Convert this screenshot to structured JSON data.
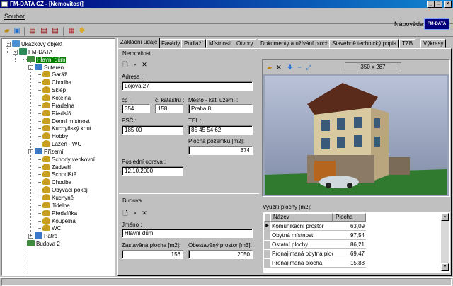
{
  "window": {
    "title": "FM-DATA CZ - [Nemovitost]"
  },
  "menu": {
    "soubor": "Soubor",
    "help": "Nápověda",
    "logo": "FM-DATA"
  },
  "tree": {
    "nodes": [
      {
        "label": "Ukázkový objekt",
        "level": 0
      },
      {
        "label": "FM-DATA",
        "level": 1
      },
      {
        "label": "Hlavní dům",
        "level": 2,
        "selected": true
      },
      {
        "label": "Suterén",
        "level": 3
      },
      {
        "label": "Garáž",
        "level": 4
      },
      {
        "label": "Chodba",
        "level": 4
      },
      {
        "label": "Sklep",
        "level": 4
      },
      {
        "label": "Kotelna",
        "level": 4
      },
      {
        "label": "Prádelna",
        "level": 4
      },
      {
        "label": "Předsíň",
        "level": 4
      },
      {
        "label": "Denní místnost",
        "level": 4
      },
      {
        "label": "Kuchyňský kout",
        "level": 4
      },
      {
        "label": "Hobby",
        "level": 4
      },
      {
        "label": "Lázeň - WC",
        "level": 4
      },
      {
        "label": "Přízemí",
        "level": 3
      },
      {
        "label": "Schody venkovní",
        "level": 4
      },
      {
        "label": "Zádveří",
        "level": 4
      },
      {
        "label": "Schodiště",
        "level": 4
      },
      {
        "label": "Chodba",
        "level": 4
      },
      {
        "label": "Obývací pokoj",
        "level": 4
      },
      {
        "label": "Kuchyně",
        "level": 4
      },
      {
        "label": "Jídelna",
        "level": 4
      },
      {
        "label": "Předsíňka",
        "level": 4
      },
      {
        "label": "Koupelna",
        "level": 4
      },
      {
        "label": "WC",
        "level": 4
      },
      {
        "label": "Patro",
        "level": 3
      },
      {
        "label": "Budova 2",
        "level": 2
      }
    ]
  },
  "tabs": [
    "Základní údaje",
    "Fasády",
    "Podlaží",
    "Místnosti",
    "Otvory",
    "Dokumenty a užívání ploch",
    "Stavebně technický popis",
    "TZB",
    "Výkresy"
  ],
  "nemovitost": {
    "title": "Nemovitost",
    "adresa_label": "Adresa :",
    "adresa": "Lojova 27",
    "cp_label": "čp :",
    "cp": "354",
    "katastr_label": "č. katastru :",
    "katastr": "158",
    "mesto_label": "Město - kat. území :",
    "mesto": "Praha 8",
    "psc_label": "PSČ :",
    "psc": "185 00",
    "tel_label": "TEL :",
    "tel": "85 45 54 62",
    "pozemek_label": "Plocha pozemku [m2]:",
    "pozemek": "874",
    "oprava_label": "Poslední oprava :",
    "oprava": "12.10.2000"
  },
  "image": {
    "size": "350 x 287"
  },
  "budova": {
    "title": "Budova",
    "jmeno_label": "Jméno :",
    "jmeno": "Hlavní dům",
    "zastavena_label": "Zastavěná plocha [m2]:",
    "zastavena": "156",
    "obestaveny_label": "Obestavěný prostor [m3]:",
    "obestaveny": "2050"
  },
  "plochy": {
    "title": "Využití plochy [m2]:",
    "col_nazev": "Název",
    "col_plocha": "Plocha",
    "rows": [
      {
        "nazev": "Komunikační prostor",
        "plocha": "63,09"
      },
      {
        "nazev": "Obytná místnost",
        "plocha": "97,54"
      },
      {
        "nazev": "Ostatní plochy",
        "plocha": "86,21"
      },
      {
        "nazev": "Pronajímaná obytná ploc",
        "plocha": "69,47"
      },
      {
        "nazev": "Pronajímaná plocha",
        "plocha": "15,88"
      }
    ]
  }
}
